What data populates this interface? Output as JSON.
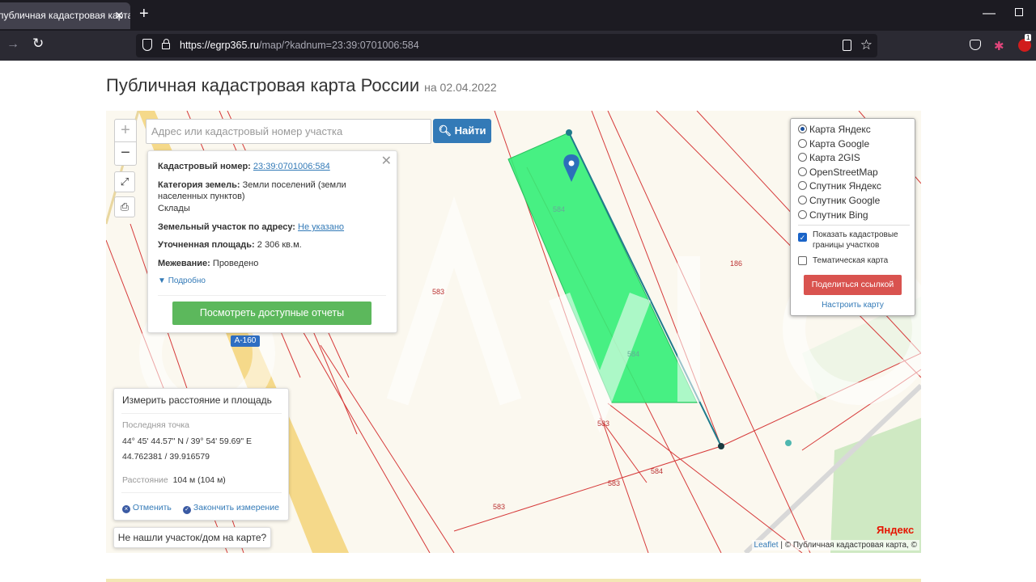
{
  "browser": {
    "tab_title": "публичная кадастровая карта",
    "tab_close": "✕",
    "new_tab": "+",
    "url_domain": "https://egrp365.ru",
    "url_rest": "/map/?kadnum=23:39:0701006:584",
    "ext_badge": "1"
  },
  "page": {
    "title": "Публичная кадастровая карта России",
    "date": "на 02.04.2022"
  },
  "map": {
    "zoom_in": "+",
    "zoom_out": "−",
    "search_placeholder": "Адрес или кадастровый номер участка",
    "search_button": "Найти",
    "road_label": "А-160",
    "parcel_labels": [
      "584",
      "584",
      "583",
      "583",
      "583",
      "583",
      "584",
      "186"
    ],
    "attribution_leaflet": "Leaflet",
    "attribution_rest": "| © Публичная кадастровая карта, ©",
    "yandex_logo": "Яндекс"
  },
  "info_popup": {
    "close": "✕",
    "cad_label": "Кадастровый номер:",
    "cad_value": "23:39:0701006:584",
    "category_label": "Категория земель:",
    "category_value": "Земли поселений (земли населенных пунктов)",
    "use": "Склады",
    "address_label": "Земельный участок по адресу:",
    "address_value": "Не указано",
    "area_label": "Уточненная площадь:",
    "area_value": "2 306 кв.м.",
    "survey_label": "Межевание:",
    "survey_value": "Проведено",
    "more": "Подробно",
    "reports_button": "Посмотреть доступные отчеты"
  },
  "layers": {
    "options": [
      {
        "label": "Карта Яндекс",
        "selected": true
      },
      {
        "label": "Карта Google",
        "selected": false
      },
      {
        "label": "Карта 2GIS",
        "selected": false
      },
      {
        "label": "OpenStreetMap",
        "selected": false
      },
      {
        "label": "Спутник Яндекс",
        "selected": false
      },
      {
        "label": "Спутник Google",
        "selected": false
      },
      {
        "label": "Спутник Bing",
        "selected": false
      }
    ],
    "show_borders_label": "Показать кадастровые границы участков",
    "show_borders_checked": true,
    "thematic_label": "Тематическая карта",
    "thematic_checked": false,
    "share_button": "Поделиться ссылкой",
    "configure_link": "Настроить карту"
  },
  "measure": {
    "title": "Измерить расстояние и площадь",
    "last_point_label": "Последняя точка",
    "coords_dms": "44° 45' 44.57\" N / 39° 54' 59.69\" E",
    "coords_dec": "44.762381 / 39.916579",
    "distance_label": "Расстояние",
    "distance_value": "104 м (104 м)",
    "cancel": "Отменить",
    "finish": "Закончить измерение"
  },
  "not_found_button": "Не нашли участок/дом на карте?",
  "colors": {
    "parcel_fill": "#33ee77",
    "parcel_line": "#d63a3a",
    "measure_line": "#1f7a8c",
    "road": "#f5d98a",
    "primary": "#337ab7",
    "success": "#5cb85c",
    "danger": "#d9534f"
  }
}
